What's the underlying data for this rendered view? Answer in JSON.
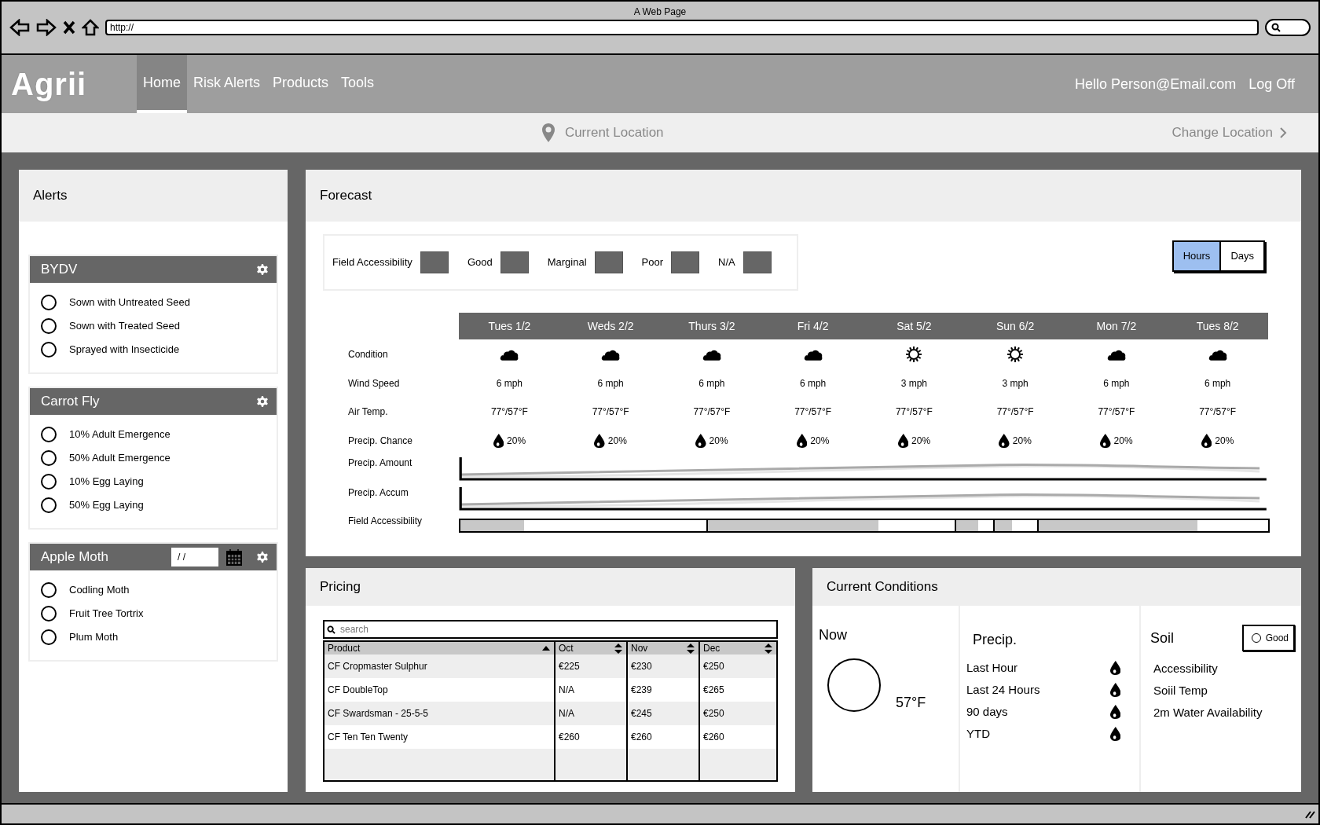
{
  "browser": {
    "title": "A Web Page",
    "url": "http://"
  },
  "nav": {
    "logo": "Agrii",
    "items": [
      {
        "label": "Home",
        "selected": true
      },
      {
        "label": "Risk Alerts",
        "selected": false
      },
      {
        "label": "Products",
        "selected": false
      },
      {
        "label": "Tools",
        "selected": false
      }
    ],
    "greeting": "Hello Person@Email.com",
    "logout": "Log Off"
  },
  "location": {
    "label": "Current Location",
    "change": "Change Location"
  },
  "alerts": {
    "title": "Alerts",
    "groups": [
      {
        "title": "BYDV",
        "options": [
          {
            "label": "Sown with Untreated Seed",
            "checked": false
          },
          {
            "label": "Sown with Treated Seed",
            "checked": false
          },
          {
            "label": "Sprayed with Insecticide",
            "checked": false
          }
        ]
      },
      {
        "title": "Carrot Fly",
        "options": [
          {
            "label": "10% Adult Emergence",
            "checked": false
          },
          {
            "label": "50% Adult Emergence",
            "checked": false
          },
          {
            "label": "10% Egg Laying",
            "checked": false
          },
          {
            "label": "50% Egg Laying",
            "checked": false
          }
        ]
      },
      {
        "title": "Apple Moth",
        "date": "/ /",
        "options": [
          {
            "label": "Codling Moth",
            "checked": false
          },
          {
            "label": "Fruit Tree Tortrix",
            "checked": false
          },
          {
            "label": "Plum Moth",
            "checked": false
          }
        ]
      }
    ]
  },
  "forecast": {
    "title": "Forecast",
    "legend": [
      "Field Accessibility",
      "Good",
      "Marginal",
      "Poor",
      "N/A"
    ],
    "views": [
      {
        "label": "Hours",
        "selected": true
      },
      {
        "label": "Days",
        "selected": false
      }
    ],
    "row_labels": [
      "Condition",
      "Wind Speed",
      "Air Temp.",
      "Precip. Chance",
      "Precip. Amount",
      "Precip. Accum",
      "Field Accessibility"
    ],
    "days": [
      {
        "label": "Tues 1/2",
        "kind": "cloudy",
        "wind": "6 mph",
        "temp": "77°/57°F",
        "precip": "20%"
      },
      {
        "label": "Weds 2/2",
        "kind": "cloudy",
        "wind": "6 mph",
        "temp": "77°/57°F",
        "precip": "20%"
      },
      {
        "label": "Thurs 3/2",
        "kind": "cloudy",
        "wind": "6 mph",
        "temp": "77°/57°F",
        "precip": "20%"
      },
      {
        "label": "Fri 4/2",
        "kind": "cloudy",
        "wind": "6 mph",
        "temp": "77°/57°F",
        "precip": "20%"
      },
      {
        "label": "Sat 5/2",
        "kind": "sunny",
        "wind": "3 mph",
        "temp": "77°/57°F",
        "precip": "20%"
      },
      {
        "label": "Sun 6/2",
        "kind": "sunny",
        "wind": "3 mph",
        "temp": "77°/57°F",
        "precip": "20%"
      },
      {
        "label": "Mon 7/2",
        "kind": "cloudy",
        "wind": "6 mph",
        "temp": "77°/57°F",
        "precip": "20%"
      },
      {
        "label": "Tues 8/2",
        "kind": "cloudy",
        "wind": "6 mph",
        "temp": "77°/57°F",
        "precip": "20%"
      }
    ],
    "accessibility": [
      {
        "level": 0.26
      },
      {
        "level": 0.69
      },
      {
        "level": 0.6
      },
      {
        "level": 0.4
      },
      {
        "level": 0.69
      }
    ]
  },
  "pricing": {
    "title": "Pricing",
    "search": {
      "placeholder": "search"
    },
    "columns": [
      {
        "label": "Product",
        "kind": "ascending"
      },
      {
        "label": "Oct",
        "kind": "sortable"
      },
      {
        "label": "Nov",
        "kind": "sortable"
      },
      {
        "label": "Dec",
        "kind": "sortable"
      }
    ],
    "rows": [
      [
        "CF Cropmaster Sulphur",
        "€225",
        "€230",
        "€250"
      ],
      [
        "CF DoubleTop",
        "N/A",
        "€239",
        "€265"
      ],
      [
        "CF Swardsman - 25-5-5",
        "N/A",
        "€245",
        "€250"
      ],
      [
        "CF Ten Ten Twenty",
        "€260",
        "€260",
        "€260"
      ]
    ]
  },
  "conditions": {
    "title": "Current Conditions",
    "now": {
      "label": "Now",
      "temp": "57°F"
    },
    "precip": {
      "title": "Precip.",
      "items": [
        "Last Hour",
        "Last 24 Hours",
        "90 days",
        "YTD"
      ]
    },
    "soil": {
      "title": "Soil",
      "status": {
        "label": "Good",
        "checked": false
      },
      "items": [
        "Accessibility",
        "Soiil Temp",
        "2m Water Availability"
      ]
    }
  }
}
